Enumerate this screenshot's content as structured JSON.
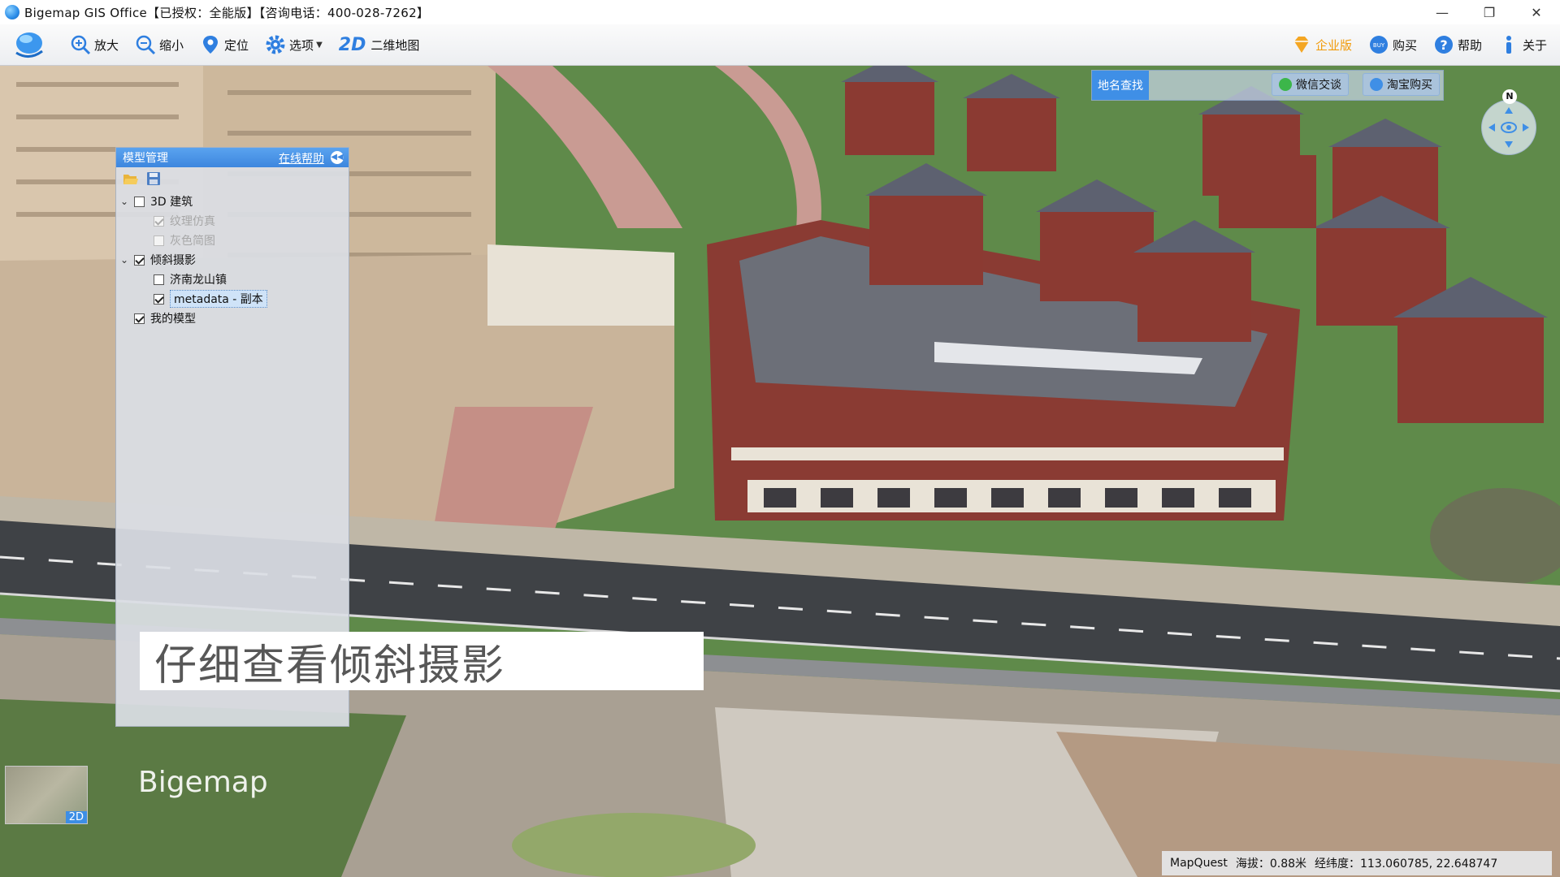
{
  "window": {
    "title": "Bigemap GIS Office【已授权：全能版】【咨询电话：400-028-7262】",
    "minimize": "—",
    "restore": "❐",
    "close": "✕"
  },
  "toolbar": {
    "zoom_in": "放大",
    "zoom_out": "缩小",
    "locate": "定位",
    "options": "选项",
    "map2d_glyph": "2D",
    "map2d": "二维地图",
    "enterprise": "企业版",
    "buy": "购买",
    "help": "帮助",
    "about": "关于",
    "accent": "#2f7fe0"
  },
  "map": {
    "search_button": "地名查找",
    "search_placeholder": "",
    "wechat": "微信交谈",
    "taobao": "淘宝购买",
    "compass_n": "N"
  },
  "panel": {
    "title": "模型管理",
    "help_link": "在线帮助",
    "tree": {
      "building3d": "3D 建筑",
      "texture": "纹理仿真",
      "grey": "灰色简图",
      "oblique": "倾斜摄影",
      "jinan": "济南龙山镇",
      "metadata": "metadata - 副本",
      "my_models": "我的模型"
    }
  },
  "caption": "仔细查看倾斜摄影",
  "watermark": "Bigemap",
  "minimap_label": "2D",
  "status": {
    "provider": "MapQuest",
    "altitude": "海拔：0.88米",
    "coords": "经纬度：113.060785, 22.648747"
  }
}
